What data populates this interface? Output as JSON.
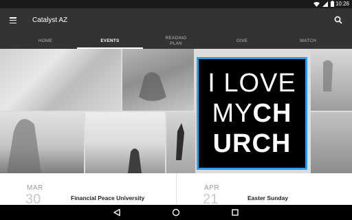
{
  "status_bar": {
    "time": "10:26",
    "icons": [
      "wifi-icon",
      "signal-icon",
      "battery-icon"
    ]
  },
  "app_bar": {
    "title": "Catalyst AZ",
    "menu_icon": "menu-icon",
    "search_icon": "search-icon"
  },
  "tabs": [
    {
      "label": "HOME",
      "active": false
    },
    {
      "label": "EVENTS",
      "active": true
    },
    {
      "label": "READING PLAN",
      "active": false
    },
    {
      "label": "GIVE",
      "active": false
    },
    {
      "label": "WATCH",
      "active": false
    }
  ],
  "hero": {
    "card_line1": "I LOVE",
    "card_line2_light": "MY",
    "card_line2_bold": "CH",
    "card_line3": "URCH",
    "card_border_color": "#2d9de4"
  },
  "events": [
    {
      "month": "MAR",
      "day": "30",
      "name": "Financial Peace University"
    },
    {
      "month": "APR",
      "day": "21",
      "name": "Easter Sunday"
    }
  ],
  "nav_bar": {
    "icons": [
      "back-icon",
      "home-icon",
      "recents-icon"
    ]
  }
}
